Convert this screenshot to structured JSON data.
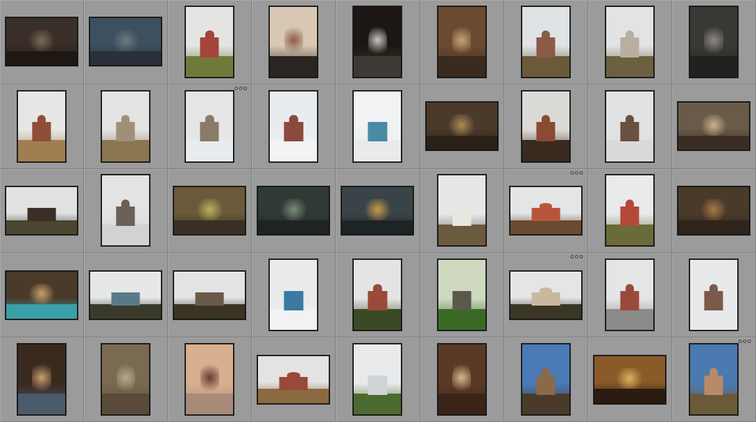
{
  "badge_text": "ooo",
  "thumbnails": [
    {
      "orient": "landscape",
      "sky": "#3a2f28",
      "ground": "#1e1814",
      "accent": "#7a6a58",
      "scene": "interior"
    },
    {
      "orient": "landscape",
      "sky": "#3d5060",
      "ground": "#2a3138",
      "accent": "#6b7a80",
      "scene": "fresco"
    },
    {
      "orient": "portrait",
      "sky": "#e4e4e2",
      "ground": "#6f7a3a",
      "accent": "#a4443a",
      "scene": "church"
    },
    {
      "orient": "portrait",
      "sky": "#d9c9b4",
      "ground": "#2b2420",
      "accent": "#8a5b48",
      "scene": "interior"
    },
    {
      "orient": "portrait",
      "sky": "#1c1714",
      "ground": "#3e3a33",
      "accent": "#c9c7c0",
      "scene": "arch"
    },
    {
      "orient": "portrait",
      "sky": "#6b4a32",
      "ground": "#3b2a1e",
      "accent": "#c8a574",
      "scene": "iconostasis"
    },
    {
      "orient": "portrait",
      "sky": "#dfe3e6",
      "ground": "#6a5a3a",
      "accent": "#8a5a44",
      "scene": "church"
    },
    {
      "orient": "portrait",
      "sky": "#e1e3e5",
      "ground": "#6d6040",
      "accent": "#b9aea0",
      "scene": "church"
    },
    {
      "orient": "portrait",
      "sky": "#3a3835",
      "ground": "#232120",
      "accent": "#8d8a85",
      "scene": "interior"
    },
    {
      "orient": "portrait",
      "sky": "#e6e6e4",
      "ground": "#a07e50",
      "accent": "#8e4e3a",
      "scene": "church"
    },
    {
      "orient": "portrait",
      "sky": "#e3e3e2",
      "ground": "#8a7650",
      "accent": "#a09078",
      "scene": "church"
    },
    {
      "orient": "portrait",
      "sky": "#e5e5e5",
      "ground": "#e9ecee",
      "accent": "#8a7a68",
      "scene": "church",
      "badge": true
    },
    {
      "orient": "portrait",
      "sky": "#e9ecef",
      "ground": "#f2f3f5",
      "accent": "#8a4a3e",
      "scene": "church"
    },
    {
      "orient": "portrait",
      "sky": "#f0f2f4",
      "ground": "#e8eaec",
      "accent": "#4a8aa6",
      "scene": "house"
    },
    {
      "orient": "landscape",
      "sky": "#4b3a2a",
      "ground": "#2a2018",
      "accent": "#b08a5a",
      "scene": "interior"
    },
    {
      "orient": "portrait",
      "sky": "#dcdad6",
      "ground": "#3a2a20",
      "accent": "#8a4a34",
      "scene": "church"
    },
    {
      "orient": "portrait",
      "sky": "#e0e2e4",
      "ground": "#d8dadc",
      "accent": "#6a5040",
      "scene": "church"
    },
    {
      "orient": "landscape",
      "sky": "#6a5a48",
      "ground": "#3a2e24",
      "accent": "#c8b090",
      "scene": "dome"
    },
    {
      "orient": "landscape",
      "sky": "#dfe1e3",
      "ground": "#4a4630",
      "accent": "#3a2e26",
      "scene": "house"
    },
    {
      "orient": "portrait",
      "sky": "#e3e3e3",
      "ground": "#d0d2d3",
      "accent": "#6a6058",
      "scene": "church"
    },
    {
      "orient": "landscape",
      "sky": "#6a5a3a",
      "ground": "#3a3024",
      "accent": "#b8b060",
      "scene": "interior"
    },
    {
      "orient": "landscape",
      "sky": "#2f3a36",
      "ground": "#1f2422",
      "accent": "#7a8a7a",
      "scene": "interior"
    },
    {
      "orient": "landscape",
      "sky": "#3a4448",
      "ground": "#1e2426",
      "accent": "#c89a4a",
      "scene": "interior"
    },
    {
      "orient": "portrait",
      "sky": "#e6e7e8",
      "ground": "#6a5a40",
      "accent": "#e8e8e0",
      "scene": "church"
    },
    {
      "orient": "landscape",
      "sky": "#e3e5e6",
      "ground": "#6a4a30",
      "accent": "#b8543a",
      "scene": "church",
      "badge": true
    },
    {
      "orient": "portrait",
      "sky": "#e8eaec",
      "ground": "#6a6a3a",
      "accent": "#b4493a",
      "scene": "church"
    },
    {
      "orient": "landscape",
      "sky": "#4a3a2a",
      "ground": "#2e241c",
      "accent": "#a87a4a",
      "scene": "interior"
    },
    {
      "orient": "landscape",
      "sky": "#4a3a2a",
      "ground": "#3aa0a8",
      "accent": "#c8a070",
      "scene": "dome"
    },
    {
      "orient": "landscape",
      "sky": "#e5e7e9",
      "ground": "#3a3a2a",
      "accent": "#5a7a8a",
      "scene": "house"
    },
    {
      "orient": "landscape",
      "sky": "#e1e3e4",
      "ground": "#3a3424",
      "accent": "#6a5a4a",
      "scene": "house"
    },
    {
      "orient": "portrait",
      "sky": "#e8eaec",
      "ground": "#f0f2f4",
      "accent": "#3a7aa0",
      "scene": "house"
    },
    {
      "orient": "portrait",
      "sky": "#e4e4e4",
      "ground": "#3a4a26",
      "accent": "#9a4a36",
      "scene": "church"
    },
    {
      "orient": "portrait",
      "sky": "#cfd9c0",
      "ground": "#3a6a26",
      "accent": "#5a5a4a",
      "scene": "house"
    },
    {
      "orient": "landscape",
      "sky": "#e3e5e6",
      "ground": "#3a3626",
      "accent": "#c8b8a0",
      "scene": "church",
      "badge": true
    },
    {
      "orient": "portrait",
      "sky": "#e3e5e6",
      "ground": "#8a8a88",
      "accent": "#9a4a3a",
      "scene": "church"
    },
    {
      "orient": "portrait",
      "sky": "#e7e9eb",
      "ground": "#e8e9ea",
      "accent": "#7a5a4a",
      "scene": "church"
    },
    {
      "orient": "portrait",
      "sky": "#3a2a1e",
      "ground": "#4a5a6a",
      "accent": "#c8a070",
      "scene": "interior"
    },
    {
      "orient": "portrait",
      "sky": "#7a6a52",
      "ground": "#5a4a3a",
      "accent": "#b8a888",
      "scene": "dome"
    },
    {
      "orient": "portrait",
      "sky": "#d8b090",
      "ground": "#a88a78",
      "accent": "#6a3a34",
      "scene": "interior"
    },
    {
      "orient": "landscape",
      "sky": "#e3e3e1",
      "ground": "#8a6a40",
      "accent": "#9a4a3a",
      "scene": "church"
    },
    {
      "orient": "portrait",
      "sky": "#e8eaec",
      "ground": "#4a6a30",
      "accent": "#d0d4d6",
      "scene": "house"
    },
    {
      "orient": "portrait",
      "sky": "#5a3a26",
      "ground": "#3a2418",
      "accent": "#d8b890",
      "scene": "arch"
    },
    {
      "orient": "portrait",
      "sky": "#4a7ab8",
      "ground": "#4a3a2a",
      "accent": "#8a6a4a",
      "scene": "church"
    },
    {
      "orient": "landscape",
      "sky": "#8a5a28",
      "ground": "#2a1c10",
      "accent": "#d8b060",
      "scene": "interior"
    },
    {
      "orient": "portrait",
      "sky": "#4a7ab0",
      "ground": "#6a5a3a",
      "accent": "#b88a6a",
      "scene": "church",
      "badge": true
    }
  ]
}
